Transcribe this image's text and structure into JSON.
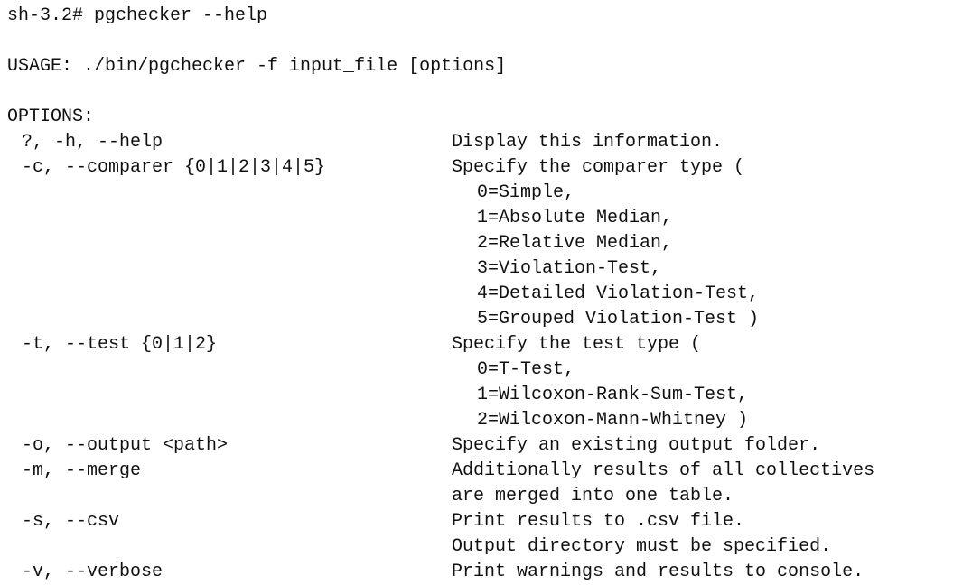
{
  "terminal": {
    "prompt": "sh-3.2#",
    "command": "pgchecker --help",
    "usage": "USAGE: ./bin/pgchecker -f input_file [options]",
    "options_title": "OPTIONS:",
    "options": {
      "help": {
        "flag": "?, -h, --help",
        "desc": [
          "Display this information."
        ]
      },
      "comparer": {
        "flag": "-c, --comparer {0|1|2|3|4|5}",
        "desc": [
          "Specify the comparer type ("
        ],
        "values": [
          "0=Simple,",
          "1=Absolute Median,",
          "2=Relative Median,",
          "3=Violation-Test,",
          "4=Detailed Violation-Test,",
          "5=Grouped Violation-Test )"
        ]
      },
      "test": {
        "flag": "-t, --test {0|1|2}",
        "desc": [
          "Specify the test type ("
        ],
        "values": [
          "0=T-Test,",
          "1=Wilcoxon-Rank-Sum-Test,",
          "2=Wilcoxon-Mann-Whitney )"
        ]
      },
      "output": {
        "flag": "-o, --output <path>",
        "desc": [
          "Specify an existing output folder."
        ]
      },
      "merge": {
        "flag": "-m, --merge",
        "desc": [
          "Additionally results of all collectives",
          "are merged into one table."
        ]
      },
      "csv": {
        "flag": "-s, --csv",
        "desc": [
          "Print results to .csv file.",
          "Output directory must be specified."
        ]
      },
      "verbose": {
        "flag": "-v, --verbose",
        "desc": [
          "Print warnings and results to console."
        ]
      }
    }
  }
}
